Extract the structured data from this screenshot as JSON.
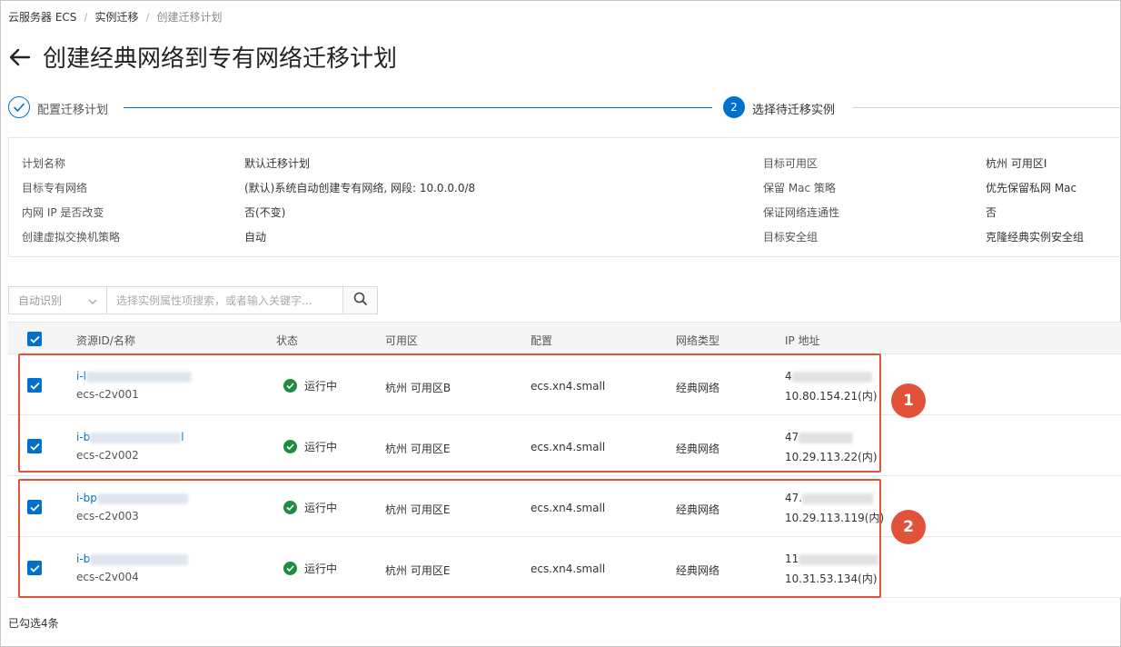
{
  "breadcrumb": [
    {
      "label": "云服务器 ECS"
    },
    {
      "label": "实例迁移"
    },
    {
      "label": "创建迁移计划"
    }
  ],
  "page_title": "创建经典网络到专有网络迁移计划",
  "steps": [
    {
      "label": "配置迁移计划"
    },
    {
      "number": "2",
      "label": "选择待迁移实例"
    }
  ],
  "info": {
    "plan_name_label": "计划名称",
    "plan_name_value": "默认迁移计划",
    "vpc_label": "目标专有网络",
    "vpc_value": "(默认)系统自动创建专有网络, 网段: 10.0.0.0/8",
    "ip_label": "内网 IP 是否改变",
    "ip_value": "否(不变)",
    "vswitch_label": "创建虚拟交换机策略",
    "vswitch_value": "自动",
    "zone_label": "目标可用区",
    "zone_value": "杭州 可用区I",
    "mac_label": "保留 Mac 策略",
    "mac_value": "优先保留私网 Mac",
    "connectivity_label": "保证网络连通性",
    "connectivity_value": "否",
    "security_group_label": "目标安全组",
    "security_group_value": "克隆经典实例安全组"
  },
  "search": {
    "select_value": "自动识别",
    "placeholder": "选择实例属性项搜索，或者输入关键字..."
  },
  "table": {
    "headers": [
      "资源ID/名称",
      "状态",
      "可用区",
      "配置",
      "网络类型",
      "IP 地址"
    ],
    "rows": [
      {
        "id_prefix": "i-l",
        "name": "ecs-c2v001",
        "status": "运行中",
        "zone": "杭州 可用区B",
        "spec": "ecs.xn4.small",
        "network": "经典网络",
        "public_ip_prefix": "4",
        "private_ip": "10.80.154.21(内)"
      },
      {
        "id_prefix": "i-b",
        "id_suffix": "l",
        "name": "ecs-c2v002",
        "status": "运行中",
        "zone": "杭州 可用区E",
        "spec": "ecs.xn4.small",
        "network": "经典网络",
        "public_ip_prefix": "47",
        "private_ip": "10.29.113.22(内)"
      },
      {
        "id_prefix": "i-bp",
        "name": "ecs-c2v003",
        "status": "运行中",
        "zone": "杭州 可用区E",
        "spec": "ecs.xn4.small",
        "network": "经典网络",
        "public_ip_prefix": "47.",
        "private_ip": "10.29.113.119(内)"
      },
      {
        "id_prefix": "i-b",
        "name": "ecs-c2v004",
        "status": "运行中",
        "zone": "杭州 可用区E",
        "spec": "ecs.xn4.small",
        "network": "经典网络",
        "public_ip_prefix": "11",
        "private_ip": "10.31.53.134(内)"
      }
    ]
  },
  "badges": [
    "1",
    "2"
  ],
  "footer": "已勾选4条",
  "colors": {
    "accent": "#0070cc",
    "annotation": "#e0533a",
    "status_ok": "#1e8e3e"
  }
}
